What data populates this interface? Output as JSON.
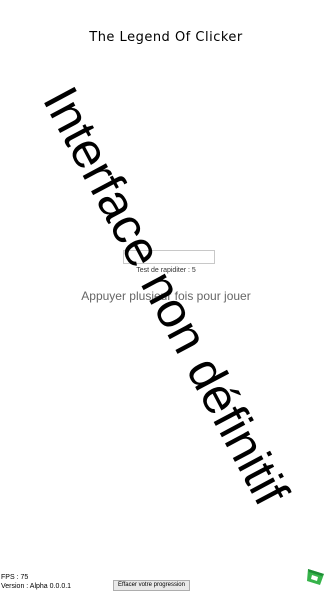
{
  "title": "The Legend Of Clicker",
  "test_input": {
    "value": ""
  },
  "test_label": "Test de rapiditer : 5",
  "hint": "Appuyer plusieur fois pour jouer",
  "watermark": "Interface non définitif",
  "footer": {
    "fps": "FPS : 75",
    "version": "Version : Alpha 0.0.0.1",
    "reset_button": "Effacer votre progression"
  },
  "icons": {
    "play_games": "google-play-games-icon"
  },
  "colors": {
    "play_games_green": "#36b34a",
    "play_games_green_dark": "#1e8c35"
  }
}
